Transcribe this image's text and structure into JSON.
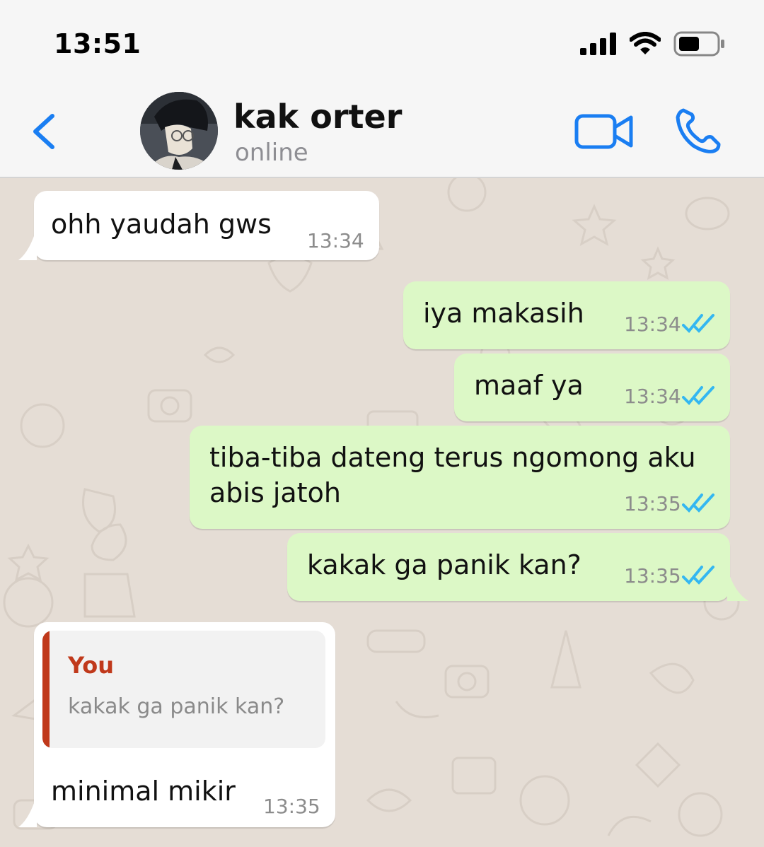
{
  "status_bar": {
    "time": "13:51"
  },
  "header": {
    "contact_name": "kak orter",
    "contact_status": "online"
  },
  "colors": {
    "accent": "#1a7ef2",
    "outgoing_bubble": "#dcf8c6",
    "incoming_bubble": "#ffffff",
    "quote_accent": "#c0391b",
    "read_ticks": "#34b7f1"
  },
  "icons": {
    "back": "chevron-left-icon",
    "video": "video-camera-icon",
    "call": "phone-icon",
    "signal": "signal-bars-icon",
    "wifi": "wifi-icon",
    "battery": "battery-icon",
    "read": "double-check-icon"
  },
  "messages": [
    {
      "direction": "incoming",
      "text": "ohh yaudah gws",
      "time": "13:34"
    },
    {
      "direction": "outgoing",
      "text": "iya makasih",
      "time": "13:34",
      "status": "read"
    },
    {
      "direction": "outgoing",
      "text": "maaf ya",
      "time": "13:34",
      "status": "read"
    },
    {
      "direction": "outgoing",
      "text": "tiba-tiba dateng terus ngomong aku\nabis jatoh",
      "time": "13:35",
      "status": "read"
    },
    {
      "direction": "outgoing",
      "text": "kakak ga panik kan?",
      "time": "13:35",
      "status": "read"
    },
    {
      "direction": "incoming",
      "reply_to": {
        "author": "You",
        "text": "kakak ga panik kan?"
      },
      "text": "minimal mikir",
      "time": "13:35"
    }
  ]
}
